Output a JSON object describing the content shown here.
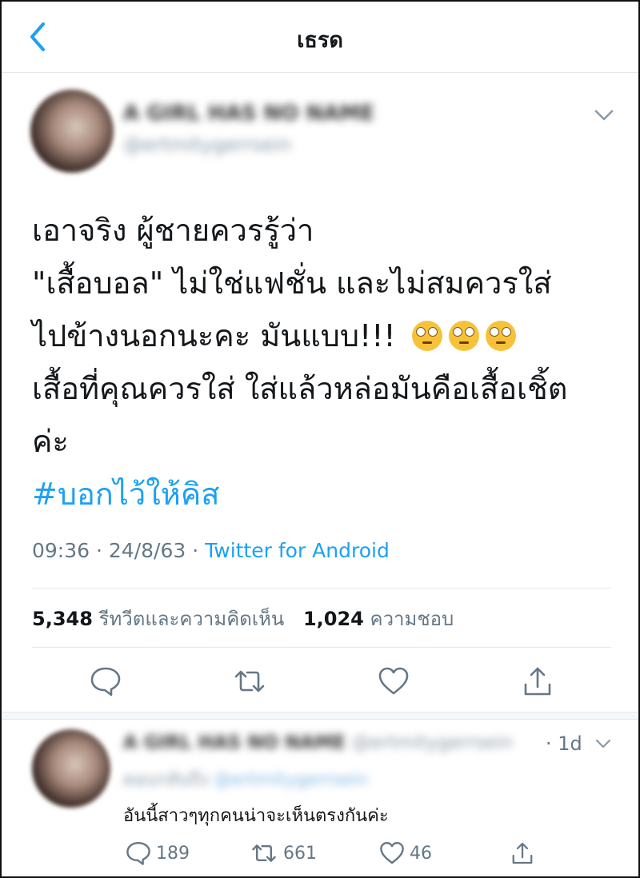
{
  "nav": {
    "title": "เธรด"
  },
  "tweet": {
    "author_name": "A GIRL HAS NO NAME",
    "author_handle": "@ertmitygerrsein",
    "lines": [
      "เอาจริง ผู้ชายควรรู้ว่า",
      "\"เสื้อบอล\" ไม่ใช่แฟชั่น และไม่สมควรใส่",
      "ไปข้างนอกนะคะ มันแบบ!!!",
      "เสื้อที่คุณควรใส่ ใส่แล้วหล่อมันคือเสื้อเชิ้ต",
      "ค่ะ"
    ],
    "hashtag": "#บอกไว้ให้คิส",
    "time": "09:36",
    "date": "24/8/63",
    "source": "Twitter for Android",
    "retweets_count": "5,348",
    "retweets_label": "รีทวีตและความคิดเห็น",
    "likes_count": "1,024",
    "likes_label": "ความชอบ"
  },
  "reply": {
    "author_name": "A GIRL HAS NO NAME",
    "author_handle": "@ertmitygerrsein",
    "reply_to": "ตอบกลับถึง",
    "time": "· 1d",
    "text": "อันนี้สาวๆทุกคนน่าจะเห็นตรงกันค่ะ",
    "reply_count": "189",
    "retweet_count": "661",
    "like_count": "46"
  },
  "colors": {
    "accent": "#1da1f2",
    "secondary_text": "#657786",
    "divider": "#e1e8ed"
  }
}
